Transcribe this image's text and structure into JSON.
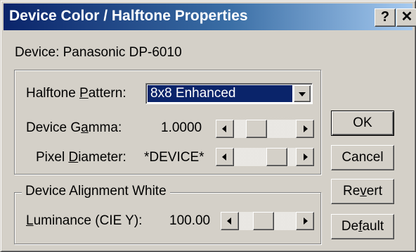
{
  "window": {
    "title": "Device Color / Halftone Properties",
    "help_glyph": "?",
    "close_glyph": "✕"
  },
  "device": {
    "label": "Device: Panasonic DP-6010"
  },
  "halftone_group": {
    "pattern": {
      "label_pre": "Halftone ",
      "label_accel": "P",
      "label_post": "attern:",
      "selected": "8x8 Enhanced"
    },
    "gamma": {
      "label_pre": "Device G",
      "label_accel": "a",
      "label_post": "mma:",
      "value": "1.0000",
      "slider_position": 0.3
    },
    "pixel_diameter": {
      "label_pre": "Pixel ",
      "label_accel": "D",
      "label_post": "iameter:",
      "value": "*DEVICE*",
      "slider_position": 0.8
    }
  },
  "alignment_group": {
    "title": "Device Alignment White",
    "luminance": {
      "label_pre": "",
      "label_accel": "L",
      "label_post": "uminance (CIE Y):",
      "value": "100.00",
      "slider_position": 0.4
    }
  },
  "buttons": {
    "ok": {
      "label": "OK"
    },
    "cancel": {
      "label": "Cancel"
    },
    "revert": {
      "pre": "Re",
      "accel": "v",
      "post": "ert"
    },
    "default": {
      "pre": "De",
      "accel": "f",
      "post": "ault"
    }
  },
  "colors": {
    "title_gradient_start": "#0a246a",
    "title_gradient_end": "#a6caf0",
    "face": "#d4d0c8",
    "selection": "#0a246a"
  }
}
